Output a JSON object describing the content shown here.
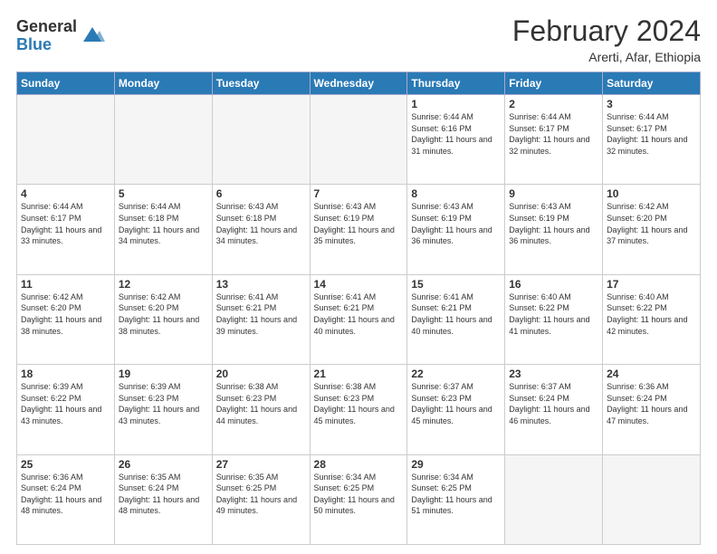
{
  "header": {
    "logo_general": "General",
    "logo_blue": "Blue",
    "month_year": "February 2024",
    "location": "Arerti, Afar, Ethiopia"
  },
  "days_of_week": [
    "Sunday",
    "Monday",
    "Tuesday",
    "Wednesday",
    "Thursday",
    "Friday",
    "Saturday"
  ],
  "weeks": [
    [
      {
        "day": "",
        "empty": true
      },
      {
        "day": "",
        "empty": true
      },
      {
        "day": "",
        "empty": true
      },
      {
        "day": "",
        "empty": true
      },
      {
        "day": "1",
        "sunrise": "6:44 AM",
        "sunset": "6:16 PM",
        "daylight": "11 hours and 31 minutes."
      },
      {
        "day": "2",
        "sunrise": "6:44 AM",
        "sunset": "6:17 PM",
        "daylight": "11 hours and 32 minutes."
      },
      {
        "day": "3",
        "sunrise": "6:44 AM",
        "sunset": "6:17 PM",
        "daylight": "11 hours and 32 minutes."
      }
    ],
    [
      {
        "day": "4",
        "sunrise": "6:44 AM",
        "sunset": "6:17 PM",
        "daylight": "11 hours and 33 minutes."
      },
      {
        "day": "5",
        "sunrise": "6:44 AM",
        "sunset": "6:18 PM",
        "daylight": "11 hours and 34 minutes."
      },
      {
        "day": "6",
        "sunrise": "6:43 AM",
        "sunset": "6:18 PM",
        "daylight": "11 hours and 34 minutes."
      },
      {
        "day": "7",
        "sunrise": "6:43 AM",
        "sunset": "6:19 PM",
        "daylight": "11 hours and 35 minutes."
      },
      {
        "day": "8",
        "sunrise": "6:43 AM",
        "sunset": "6:19 PM",
        "daylight": "11 hours and 36 minutes."
      },
      {
        "day": "9",
        "sunrise": "6:43 AM",
        "sunset": "6:19 PM",
        "daylight": "11 hours and 36 minutes."
      },
      {
        "day": "10",
        "sunrise": "6:42 AM",
        "sunset": "6:20 PM",
        "daylight": "11 hours and 37 minutes."
      }
    ],
    [
      {
        "day": "11",
        "sunrise": "6:42 AM",
        "sunset": "6:20 PM",
        "daylight": "11 hours and 38 minutes."
      },
      {
        "day": "12",
        "sunrise": "6:42 AM",
        "sunset": "6:20 PM",
        "daylight": "11 hours and 38 minutes."
      },
      {
        "day": "13",
        "sunrise": "6:41 AM",
        "sunset": "6:21 PM",
        "daylight": "11 hours and 39 minutes."
      },
      {
        "day": "14",
        "sunrise": "6:41 AM",
        "sunset": "6:21 PM",
        "daylight": "11 hours and 40 minutes."
      },
      {
        "day": "15",
        "sunrise": "6:41 AM",
        "sunset": "6:21 PM",
        "daylight": "11 hours and 40 minutes."
      },
      {
        "day": "16",
        "sunrise": "6:40 AM",
        "sunset": "6:22 PM",
        "daylight": "11 hours and 41 minutes."
      },
      {
        "day": "17",
        "sunrise": "6:40 AM",
        "sunset": "6:22 PM",
        "daylight": "11 hours and 42 minutes."
      }
    ],
    [
      {
        "day": "18",
        "sunrise": "6:39 AM",
        "sunset": "6:22 PM",
        "daylight": "11 hours and 43 minutes."
      },
      {
        "day": "19",
        "sunrise": "6:39 AM",
        "sunset": "6:23 PM",
        "daylight": "11 hours and 43 minutes."
      },
      {
        "day": "20",
        "sunrise": "6:38 AM",
        "sunset": "6:23 PM",
        "daylight": "11 hours and 44 minutes."
      },
      {
        "day": "21",
        "sunrise": "6:38 AM",
        "sunset": "6:23 PM",
        "daylight": "11 hours and 45 minutes."
      },
      {
        "day": "22",
        "sunrise": "6:37 AM",
        "sunset": "6:23 PM",
        "daylight": "11 hours and 45 minutes."
      },
      {
        "day": "23",
        "sunrise": "6:37 AM",
        "sunset": "6:24 PM",
        "daylight": "11 hours and 46 minutes."
      },
      {
        "day": "24",
        "sunrise": "6:36 AM",
        "sunset": "6:24 PM",
        "daylight": "11 hours and 47 minutes."
      }
    ],
    [
      {
        "day": "25",
        "sunrise": "6:36 AM",
        "sunset": "6:24 PM",
        "daylight": "11 hours and 48 minutes."
      },
      {
        "day": "26",
        "sunrise": "6:35 AM",
        "sunset": "6:24 PM",
        "daylight": "11 hours and 48 minutes."
      },
      {
        "day": "27",
        "sunrise": "6:35 AM",
        "sunset": "6:25 PM",
        "daylight": "11 hours and 49 minutes."
      },
      {
        "day": "28",
        "sunrise": "6:34 AM",
        "sunset": "6:25 PM",
        "daylight": "11 hours and 50 minutes."
      },
      {
        "day": "29",
        "sunrise": "6:34 AM",
        "sunset": "6:25 PM",
        "daylight": "11 hours and 51 minutes."
      },
      {
        "day": "",
        "empty": true
      },
      {
        "day": "",
        "empty": true
      }
    ]
  ]
}
